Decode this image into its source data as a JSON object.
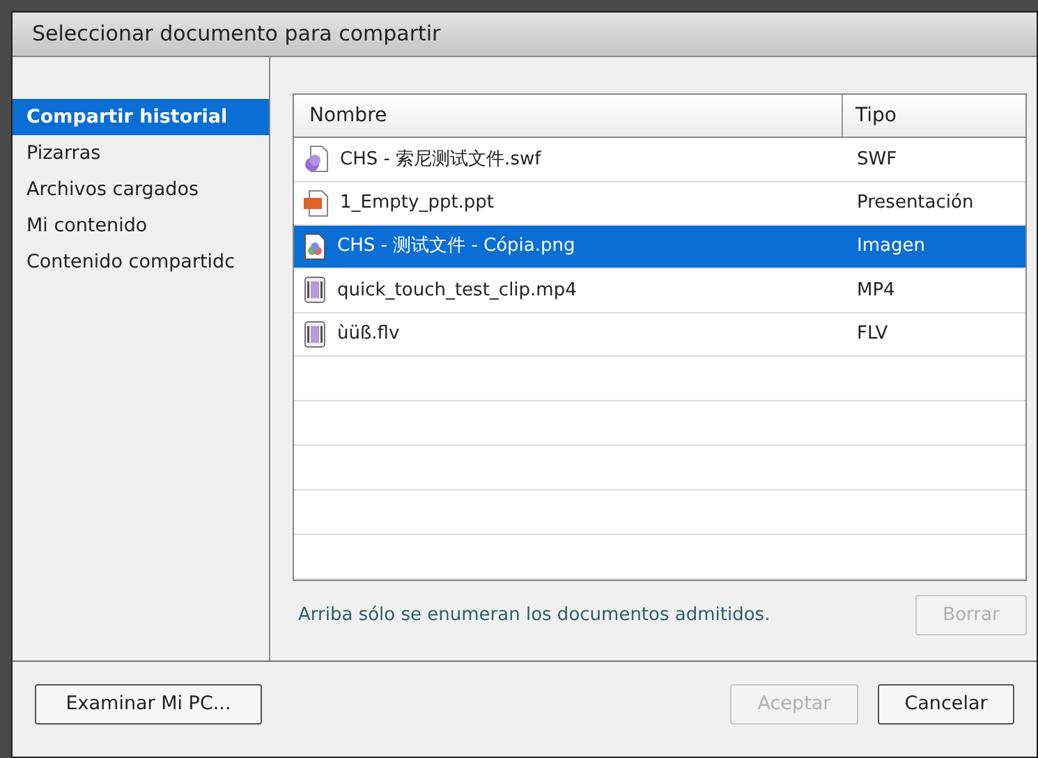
{
  "window": {
    "title": "Seleccionar documento para compartir"
  },
  "sidebar": {
    "items": [
      {
        "label": "Compartir historial",
        "selected": true
      },
      {
        "label": "Pizarras",
        "selected": false
      },
      {
        "label": "Archivos cargados",
        "selected": false
      },
      {
        "label": "Mi contenido",
        "selected": false
      },
      {
        "label": "Contenido compartidc",
        "selected": false
      }
    ]
  },
  "table": {
    "columns": [
      "Nombre",
      "Tipo"
    ],
    "rows": [
      {
        "name": "CHS - 索尼测试文件.swf",
        "type": "SWF",
        "kind": "swf",
        "selected": false
      },
      {
        "name": "1_Empty_ppt.ppt",
        "type": "Presentación",
        "kind": "ppt",
        "selected": false
      },
      {
        "name": "CHS - 测试文件 - Cópia.png",
        "type": "Imagen",
        "kind": "image",
        "selected": true
      },
      {
        "name": "quick_touch_test_clip.mp4",
        "type": "MP4",
        "kind": "video",
        "selected": false
      },
      {
        "name": "ùüß.flv",
        "type": "FLV",
        "kind": "video",
        "selected": false
      }
    ]
  },
  "note": "Arriba sólo se enumeran los documentos admitidos.",
  "delete_button": {
    "label": "Borrar",
    "disabled": true
  },
  "browse_button": {
    "label": "Examinar Mi PC..."
  },
  "ok_button": {
    "label": "Aceptar",
    "disabled": true
  },
  "cancel_button": {
    "label": "Cancelar",
    "disabled": false
  }
}
